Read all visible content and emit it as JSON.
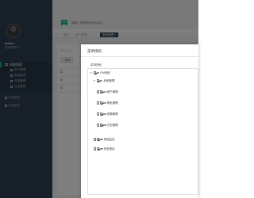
{
  "sidebar": {
    "profile": {
      "name": "admin",
      "role": "超级管理员 ▾"
    },
    "group": {
      "label": "系统管理"
    },
    "subitems": [
      {
        "label": "用户管理"
      },
      {
        "label": "角色管理"
      },
      {
        "label": "资源管理"
      },
      {
        "label": "日志管理"
      }
    ],
    "items": [
      {
        "label": "系统监控"
      },
      {
        "label": "安全退出"
      }
    ]
  },
  "topbar": {
    "search_placeholder": "请输入您需要查找的内容 ..."
  },
  "tabs": [
    {
      "label": "首页"
    },
    {
      "label": "用户管理 ×"
    },
    {
      "label": "角色管理 ×"
    }
  ],
  "background": {
    "filter_label": "角色名称",
    "add_button": "+添加"
  },
  "modal": {
    "title": "菜单授权",
    "tree_label": "菜单授权",
    "tree": {
      "root": "EM系统",
      "group": "系统管理",
      "children": [
        "用户管理",
        "角色管理",
        "资源管理",
        "日志管理"
      ],
      "others": [
        "系统监控",
        "安全退出"
      ]
    }
  }
}
